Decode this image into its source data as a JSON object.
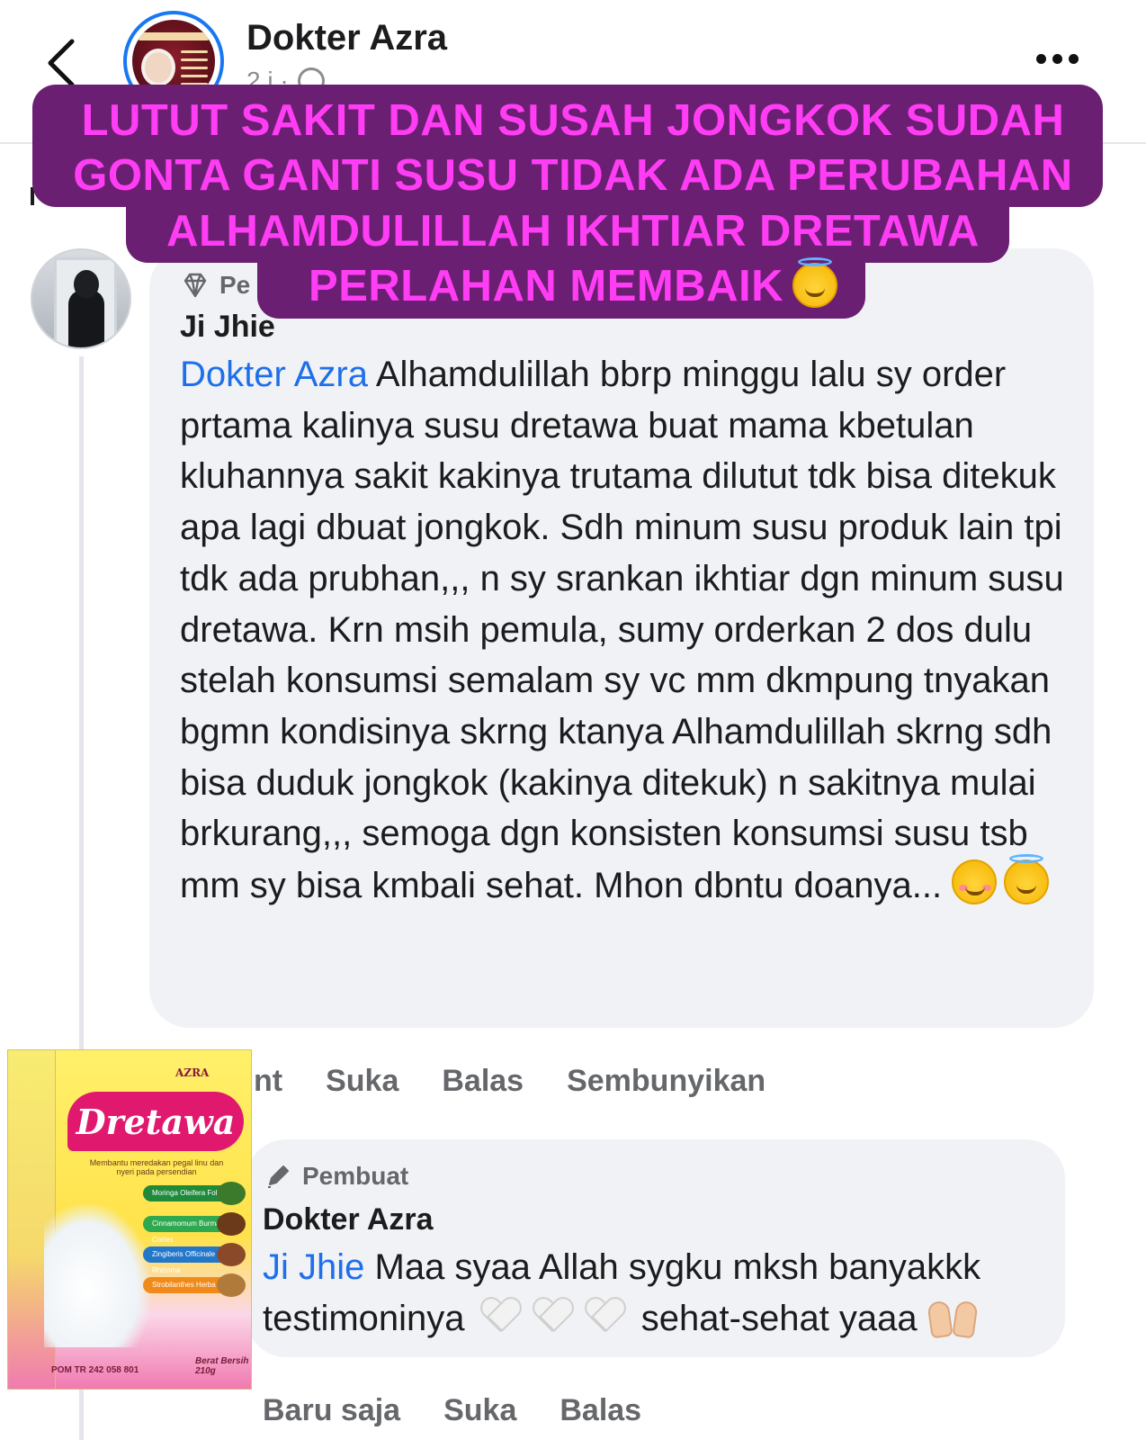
{
  "header": {
    "page_name": "Dokter Azra",
    "time": "2 j ·"
  },
  "overlay_caption": {
    "lines": [
      "LUTUT SAKIT DAN SUSAH JONGKOK SUDAH",
      "GONTA GANTI SUSU TIDAK ADA PERUBAHAN",
      "ALHAMDULILLAH IKHTIAR DRETAWA",
      "PERLAHAN MEMBAIK"
    ],
    "emoji": "smiling-face-with-halo"
  },
  "comment_1": {
    "badge": "Pe",
    "author": "Ji Jhie",
    "mention": "Dokter Azra",
    "text": " Alhamdulillah bbrp minggu lalu sy order prtama kalinya susu dretawa buat mama kbetulan kluhannya sakit kakinya trutama dilutut tdk bisa ditekuk apa lagi dbuat jongkok. Sdh minum susu produk lain tpi tdk ada prubhan,,, n sy srankan ikhtiar dgn minum susu dretawa. Krn msih pemula, sumy orderkan 2 dos dulu stelah konsumsi semalam sy vc mm dkmpung tnyakan bgmn kondisinya skrng ktanya Alhamdulillah skrng sdh bisa duduk jongkok (kakinya ditekuk) n sakitnya mulai brkurang,,, semoga dgn konsisten konsumsi susu tsb mm sy bisa kmbali sehat. Mhon dbntu doanya... ",
    "actions": [
      "nt",
      "Suka",
      "Balas",
      "Sembunyikan"
    ]
  },
  "comment_2": {
    "badge": "Pembuat",
    "author": "Dokter Azra",
    "mention": "Ji Jhie",
    "text_a": " Maa syaa Allah sygku mksh banyakkk testimoninya ",
    "text_b": " sehat-sehat yaaa ",
    "actions": [
      "Baru saja",
      "Suka",
      "Balas"
    ]
  },
  "product": {
    "brand": "AZRA",
    "name": "Dretawa",
    "tagline": "Membantu meredakan pegal linu dan nyeri pada persendian",
    "ingredients": [
      "Moringa Oleifera Folium",
      "Cinnamomum Burmanni Cortex",
      "Zingiberis Officinale Rhizoma",
      "Strobilanthes Herba"
    ],
    "registration": "POM TR 242 058 801",
    "net_weight": "Berat Bersih 210g"
  }
}
